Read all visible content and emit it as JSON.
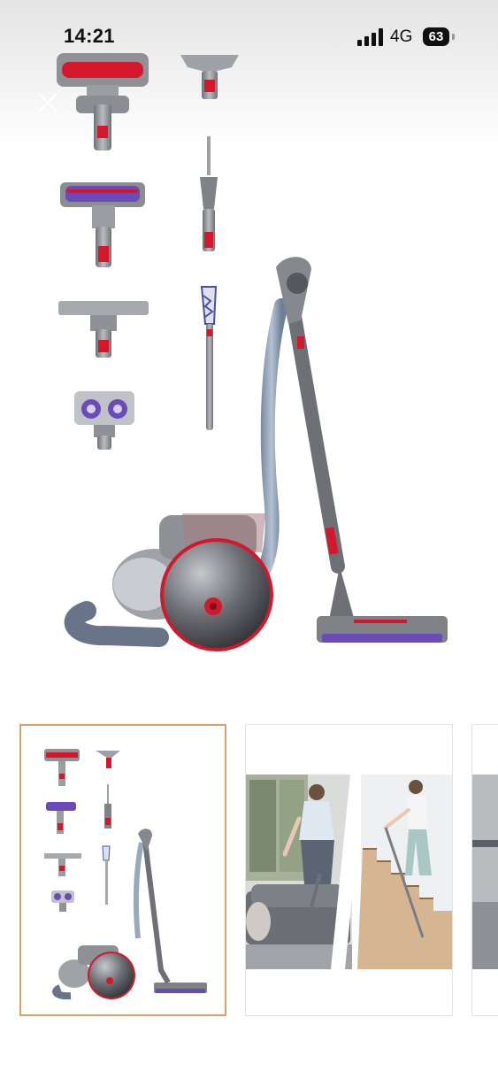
{
  "status_bar": {
    "time": "14:21",
    "network": "4G",
    "battery": "63"
  },
  "colors": {
    "accent_red": "#d4172a",
    "body_grey": "#8a8d93",
    "purple_brush": "#6a4bb8",
    "selected_border": "#d9a06a"
  },
  "icons": {
    "close": "close-x-icon",
    "signal": "cellular-signal-icon",
    "battery": "battery-icon"
  },
  "gallery": {
    "selected_index": 0,
    "thumbnails": [
      "product-overview",
      "lifestyle-cleaning",
      "partial-next"
    ]
  }
}
